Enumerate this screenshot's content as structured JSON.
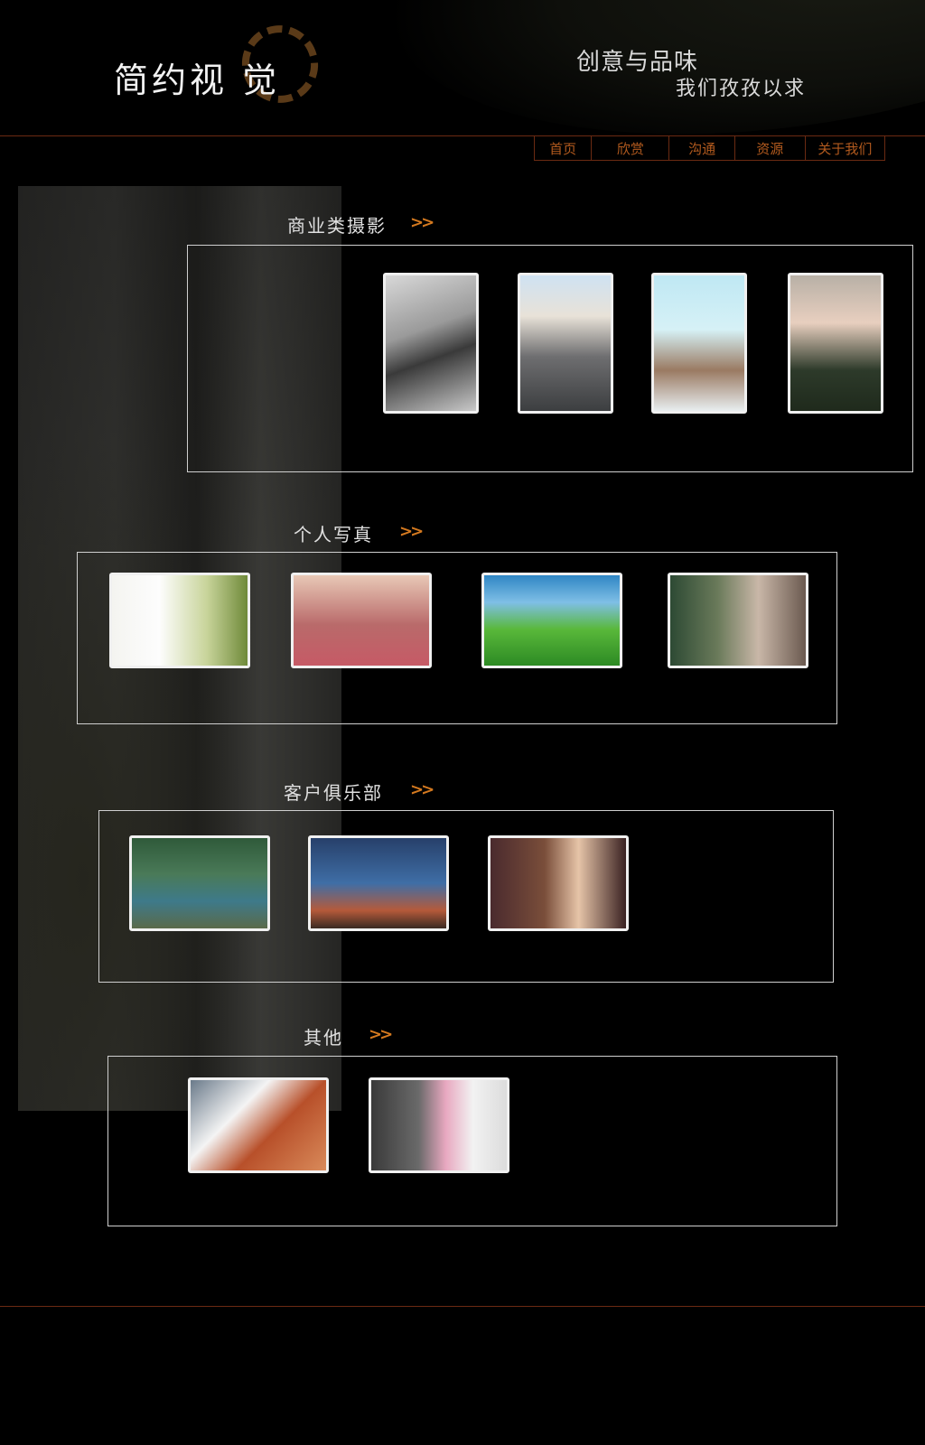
{
  "header": {
    "logo_text": "简约视 觉",
    "tagline_line1": "创意与品味",
    "tagline_line2": "我们孜孜以求"
  },
  "nav": {
    "items": [
      "首页",
      "欣赏",
      "沟通",
      "资源",
      "关于我们"
    ]
  },
  "sections": [
    {
      "title": "商业类摄影",
      "arrow": ">>",
      "photo_count": 4
    },
    {
      "title": "个人写真",
      "arrow": ">>",
      "photo_count": 4
    },
    {
      "title": "客户俱乐部",
      "arrow": ">>",
      "photo_count": 3
    },
    {
      "title": "其他",
      "arrow": ">>",
      "photo_count": 2
    }
  ],
  "colors": {
    "background": "#000000",
    "accent_orange": "#d4791f",
    "nav_text": "#b25a1e",
    "rule_line": "#6b2a12",
    "frame_border": "#cfcfcf",
    "thumb_border": "#f0f0f0"
  }
}
